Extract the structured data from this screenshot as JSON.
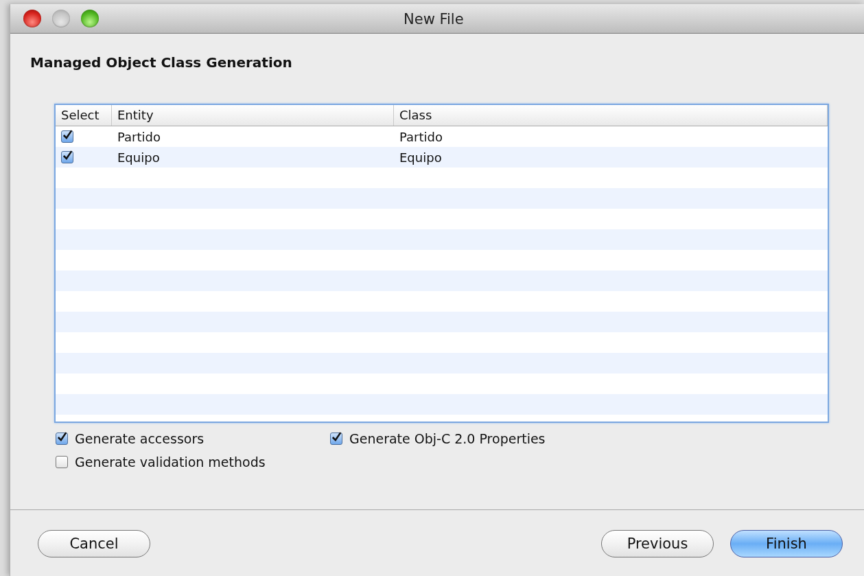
{
  "window": {
    "title": "New File"
  },
  "heading": "Managed Object Class Generation",
  "table": {
    "columns": [
      "Select",
      "Entity",
      "Class"
    ],
    "rows": [
      {
        "checked": true,
        "entity": "Partido",
        "class": "Partido"
      },
      {
        "checked": true,
        "entity": "Equipo",
        "class": "Equipo"
      }
    ]
  },
  "options": [
    {
      "label": "Generate accessors",
      "checked": true
    },
    {
      "label": "Generate Obj-C 2.0 Properties",
      "checked": true
    },
    {
      "label": "Generate validation methods",
      "checked": false
    }
  ],
  "buttons": [
    {
      "label": "Cancel",
      "default": false
    },
    {
      "label": "Previous",
      "default": false
    },
    {
      "label": "Finish",
      "default": true
    }
  ]
}
